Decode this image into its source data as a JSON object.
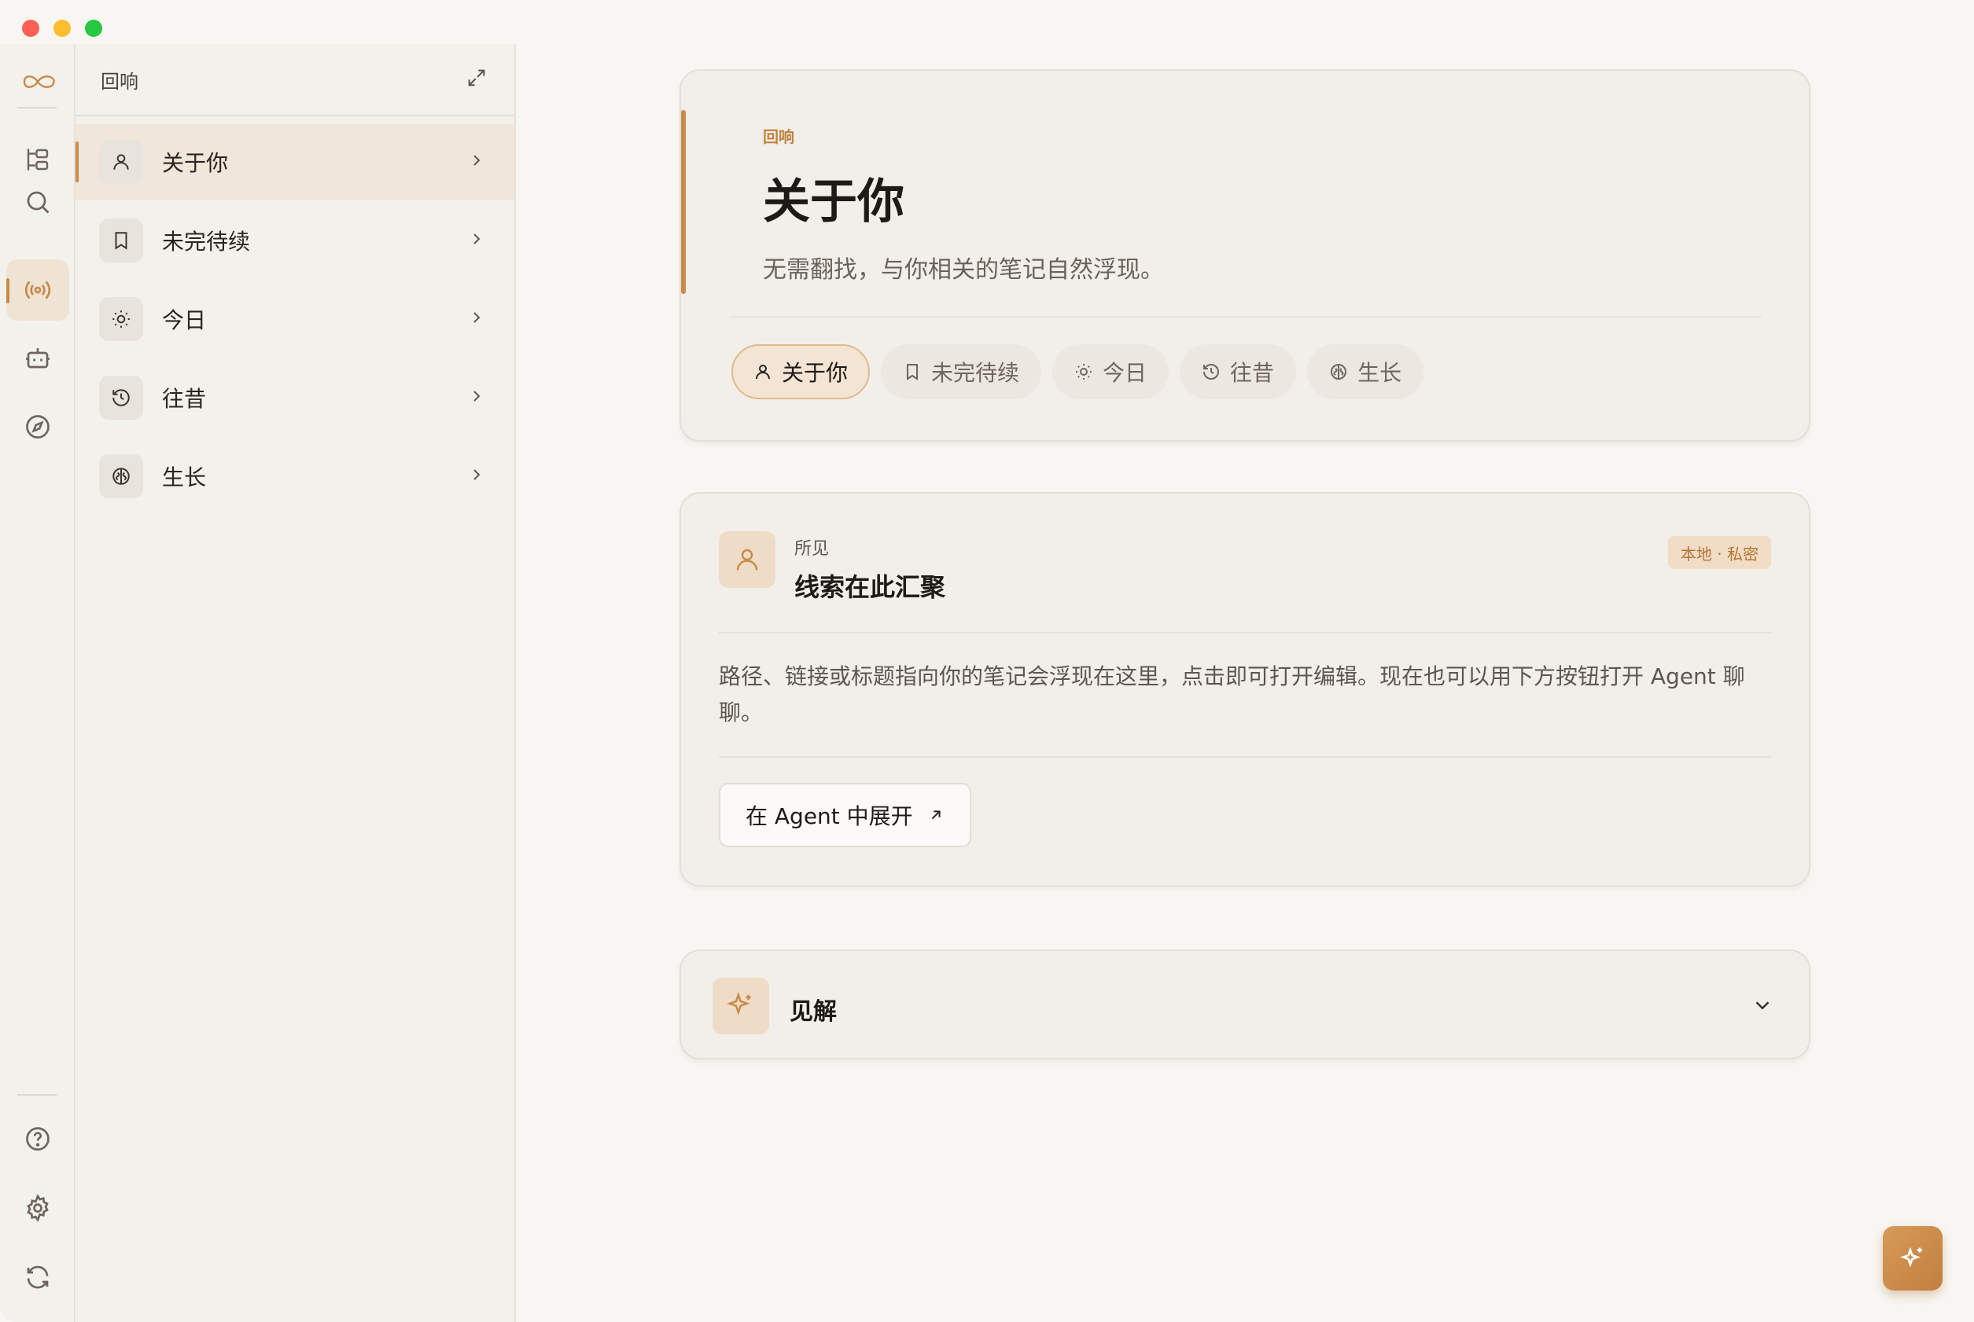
{
  "sidebar": {
    "title": "回响",
    "items": [
      {
        "label": "关于你",
        "icon": "user-icon"
      },
      {
        "label": "未完待续",
        "icon": "bookmark-icon"
      },
      {
        "label": "今日",
        "icon": "sun-icon"
      },
      {
        "label": "往昔",
        "icon": "history-icon"
      },
      {
        "label": "生长",
        "icon": "brain-icon"
      }
    ]
  },
  "rail": {
    "top": [
      "logo-icon",
      "tree-icon",
      "search-icon",
      "radio-icon",
      "bot-icon",
      "compass-icon"
    ],
    "bottom": [
      "help-icon",
      "settings-icon",
      "sync-icon"
    ],
    "active": "radio-icon"
  },
  "hero": {
    "eyebrow": "回响",
    "title": "关于你",
    "subtitle": "无需翻找，与你相关的笔记自然浮现。",
    "pills": [
      {
        "label": "关于你",
        "active": true
      },
      {
        "label": "未完待续",
        "active": false
      },
      {
        "label": "今日",
        "active": false
      },
      {
        "label": "往昔",
        "active": false
      },
      {
        "label": "生长",
        "active": false
      }
    ]
  },
  "suoji": {
    "label": "所见",
    "title": "线索在此汇聚",
    "badge": "本地 · 私密",
    "body": "路径、链接或标题指向你的笔记会浮现在这里，点击即可打开编辑。现在也可以用下方按钮打开 Agent 聊聊。",
    "button": "在 Agent 中展开"
  },
  "insight": {
    "label": "见解"
  },
  "colors": {
    "accent": "#c98a4a",
    "background": "#f8f6f2",
    "panel": "#f3f1ec"
  }
}
